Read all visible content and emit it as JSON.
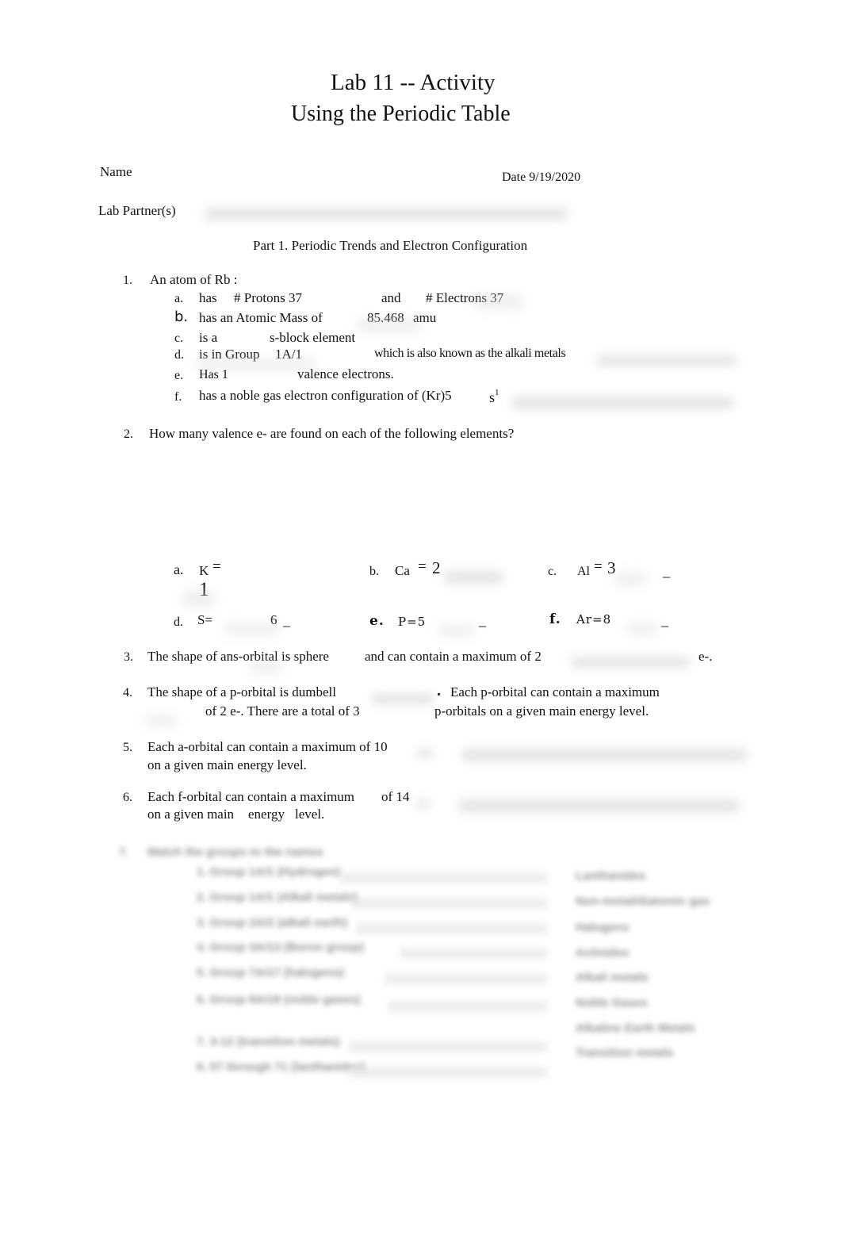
{
  "header": {
    "title": "Lab 11 -- Activity",
    "subtitle": "Using the Periodic Table"
  },
  "info": {
    "name_label": "Name",
    "date_label": "Date 9/19/2020",
    "partners_label": "Lab  Partner(s)"
  },
  "part1": {
    "heading": "Part 1. Periodic Trends and Electron Configuration"
  },
  "q1": {
    "number": "1.",
    "stem": "An atom of Rb :",
    "a": {
      "letter": "a.",
      "t1": "has",
      "t2": "#  Protons 37",
      "t3": "and",
      "t4": "# Electrons  37"
    },
    "b": {
      "letter": "b.",
      "t1": "has an Atomic Mass of",
      "t2": "85.468",
      "t3": "amu"
    },
    "c": {
      "letter": "c.",
      "t1": "is a",
      "t2": "s-block element"
    },
    "d": {
      "letter": "d.",
      "t1": "is in Group",
      "t2": "1A/1",
      "t3": "which is also known as the alkali metals"
    },
    "e": {
      "letter": "e.",
      "t1": "Has 1",
      "t2": "valence electrons."
    },
    "f": {
      "letter": "f.",
      "t1": "has a noble gas electron configuration of (Kr)5",
      "t2": "s",
      "t3": "1"
    }
  },
  "q2": {
    "number": "2.",
    "stem": "How many valence e- are found on each of the following elements?",
    "items": [
      {
        "letter": "a.",
        "element": "K",
        "eq": "=",
        "answer": "1"
      },
      {
        "letter": "b.",
        "element": "Ca",
        "eq": "=",
        "answer": "2"
      },
      {
        "letter": "c.",
        "element": "Al",
        "eq": "=",
        "answer": "3",
        "blank": "_"
      },
      {
        "letter": "d.",
        "element": "S=",
        "answer": "6",
        "blank": "_"
      },
      {
        "letter": "e.",
        "element": "P=5",
        "blank": "_"
      },
      {
        "letter": "f.",
        "element": "Ar=8",
        "blank": "_"
      }
    ]
  },
  "q3": {
    "number": "3.",
    "t1": "The shape of ans-orbital is sphere",
    "t2": "and can contain a maximum of 2",
    "t3": "e-."
  },
  "q4": {
    "number": "4.",
    "t1": "The shape of a p-orbital is dumbell",
    "t2": ".",
    "t3": "Each p-orbital can contain a maximum",
    "t4": "of 2 e-. There are a total of 3",
    "t5": "p-orbitals on a given main energy level."
  },
  "q5": {
    "number": "5.",
    "line1": "Each a-orbital can contain a maximum of 10",
    "line2": "on a given main energy level."
  },
  "q6": {
    "number": "6.",
    "line1a": "Each f-orbital can contain a maximum",
    "line1b": "of 14",
    "line2a": "on a given main",
    "line2b": "energy",
    "line2c": "level."
  },
  "q7": {
    "number": "7.",
    "stem": "Match the groups to the names",
    "left_items": [
      "1. Group 1A/1 (Hydrogen)",
      "2. Group 1A/1 (Alkali metals)",
      "3. Group 2A/2 (alkali earth)",
      "4. Group 3A/13 (Boron group)",
      "5. Group 7A/17 (halogens)",
      "6. Group 8A/18 (noble gases)",
      "7. 3-12 (transition metals)",
      "8. 57 through 71 (lanthanides)"
    ],
    "right_items": [
      "Lanthanides",
      "Non-metal/diatomic gas",
      "Halogens",
      "Actinides",
      "Alkali metals",
      "Noble Gases",
      "Alkaline Earth Metals",
      "Transition metals"
    ]
  }
}
